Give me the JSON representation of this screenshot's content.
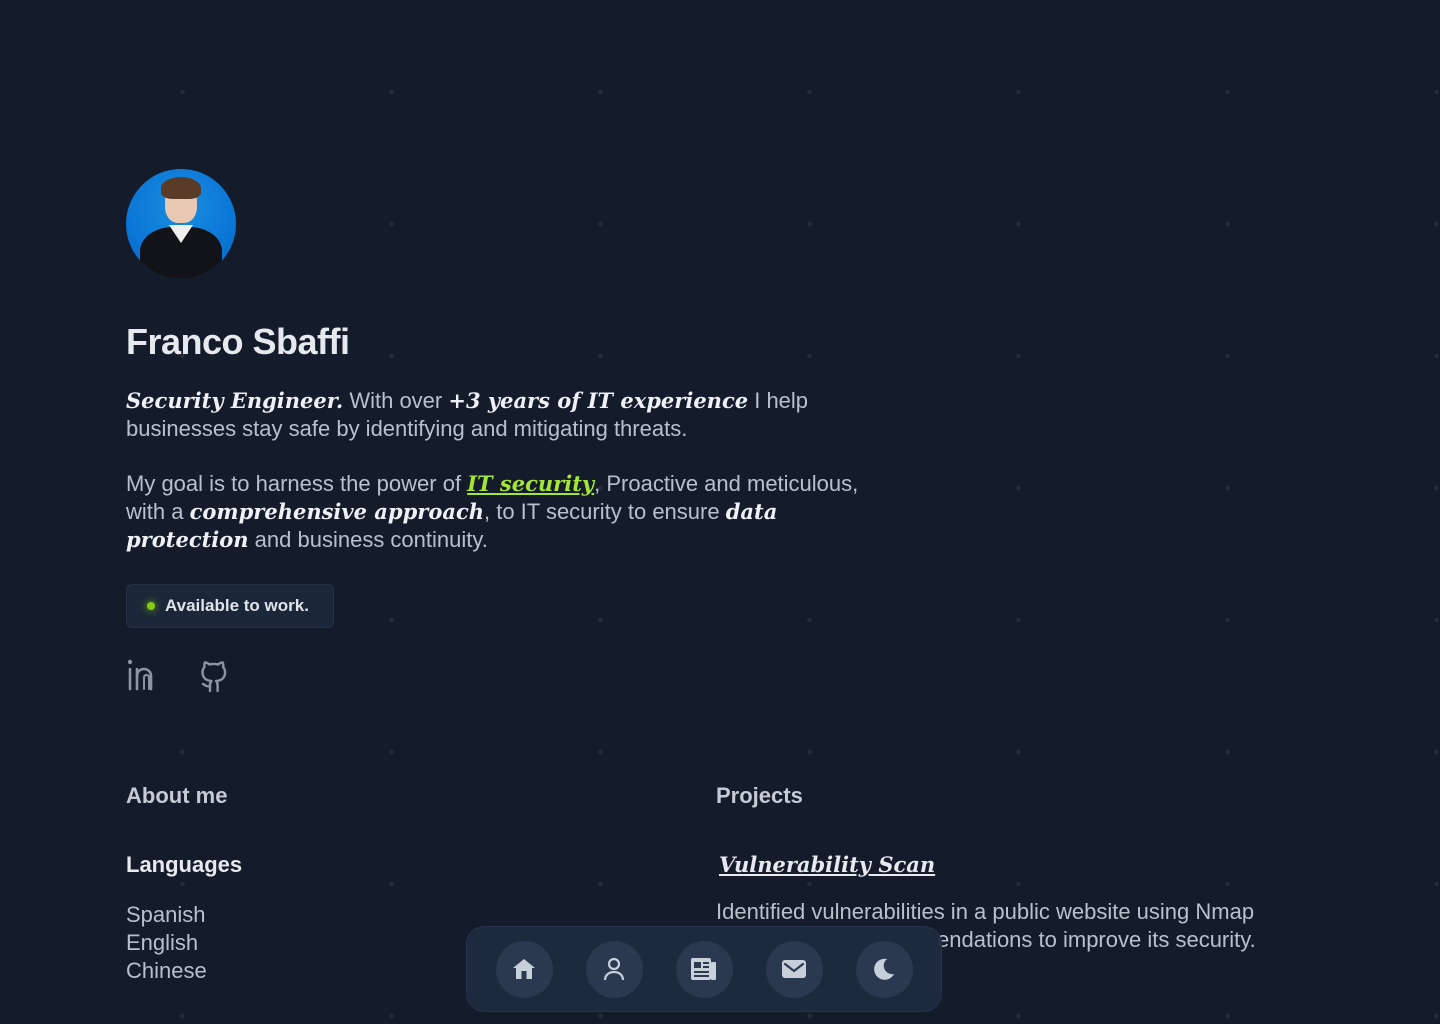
{
  "profile": {
    "name": "Franco Sbaffi",
    "avatar_alt": "Profile photo"
  },
  "bio": {
    "p1": {
      "role": "Security Engineer.",
      "t1": " With over ",
      "experience": "+3 years of IT experience",
      "t2": " I help businesses stay safe by identifying and mitigating threats."
    },
    "p2": {
      "t1": "My goal is to harness the power of ",
      "link": "IT security",
      "t2": ", Proactive and meticulous, with a ",
      "approach": "comprehensive approach",
      "t3": ", to IT security to ensure ",
      "protection": "data protection",
      "t4": " and business continuity."
    }
  },
  "status": {
    "label": "Available to work.",
    "color": "#84cc16"
  },
  "socials": [
    {
      "icon": "linkedin-icon"
    },
    {
      "icon": "github-icon"
    }
  ],
  "about": {
    "title": "About me",
    "languages_title": "Languages",
    "languages": [
      "Spanish",
      "English",
      "Chinese"
    ]
  },
  "projects": {
    "title": "Projects",
    "items": [
      {
        "title": "Vulnerability Scan",
        "description_line1": "Identified vulnerabilities in a public website using Nmap",
        "description_line2": "endations to improve its security."
      }
    ]
  },
  "dock": {
    "items": [
      {
        "icon": "home-icon"
      },
      {
        "icon": "user-icon"
      },
      {
        "icon": "newspaper-icon"
      },
      {
        "icon": "mail-icon"
      },
      {
        "icon": "moon-icon"
      }
    ]
  },
  "colors": {
    "background": "#141c2b",
    "accent": "#a3e635",
    "avatar_bg": "#0a76d6"
  }
}
